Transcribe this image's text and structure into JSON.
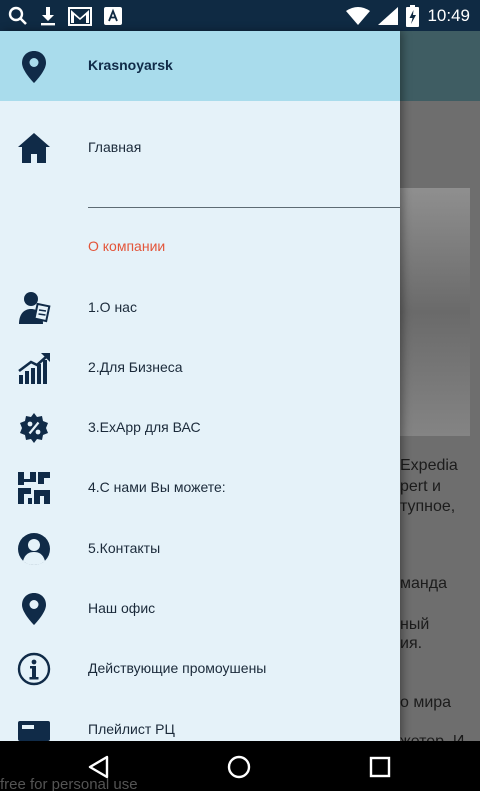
{
  "status_bar": {
    "time": "10:49",
    "left_icons": [
      "search-icon",
      "download-icon",
      "gmail-icon",
      "font-icon"
    ],
    "right_icons": [
      "wifi-icon",
      "signal-icon",
      "battery-icon"
    ]
  },
  "drawer": {
    "header": {
      "city": "Krasnoyarsk",
      "icon": "location-pin-icon"
    },
    "home": {
      "label": "Главная",
      "icon": "home-icon"
    },
    "section_title": "О компании",
    "items": [
      {
        "label": "1.О нас",
        "icon": "person-document-icon"
      },
      {
        "label": "2.Для Бизнеса",
        "icon": "growth-chart-icon"
      },
      {
        "label": "3.ExApp для ВАС",
        "icon": "percent-badge-icon"
      },
      {
        "label": "4.С нами Вы можете:",
        "icon": "pattern-icon"
      },
      {
        "label": "5.Контакты",
        "icon": "contact-avatar-icon"
      },
      {
        "label": "Наш офис",
        "icon": "location-pin-icon"
      },
      {
        "label": "Действующие промоушены",
        "icon": "info-icon"
      },
      {
        "label": "Плейлист РЦ",
        "icon": "ticket-icon"
      }
    ]
  },
  "background": {
    "lines": [
      "Expedia",
      "pert и",
      "тупное,",
      "манда",
      "ный",
      "ия.",
      "о мира",
      "жетер. И"
    ]
  },
  "nav_bar": {
    "buttons": [
      "back-icon",
      "home-circle-icon",
      "recents-icon"
    ]
  },
  "watermark": "free for personal use",
  "colors": {
    "status_bar": "#0f2a43",
    "drawer_bg": "#e5f2f9",
    "drawer_header": "#a9dcec",
    "icon_navy": "#102b48",
    "section_accent": "#e3553a"
  }
}
